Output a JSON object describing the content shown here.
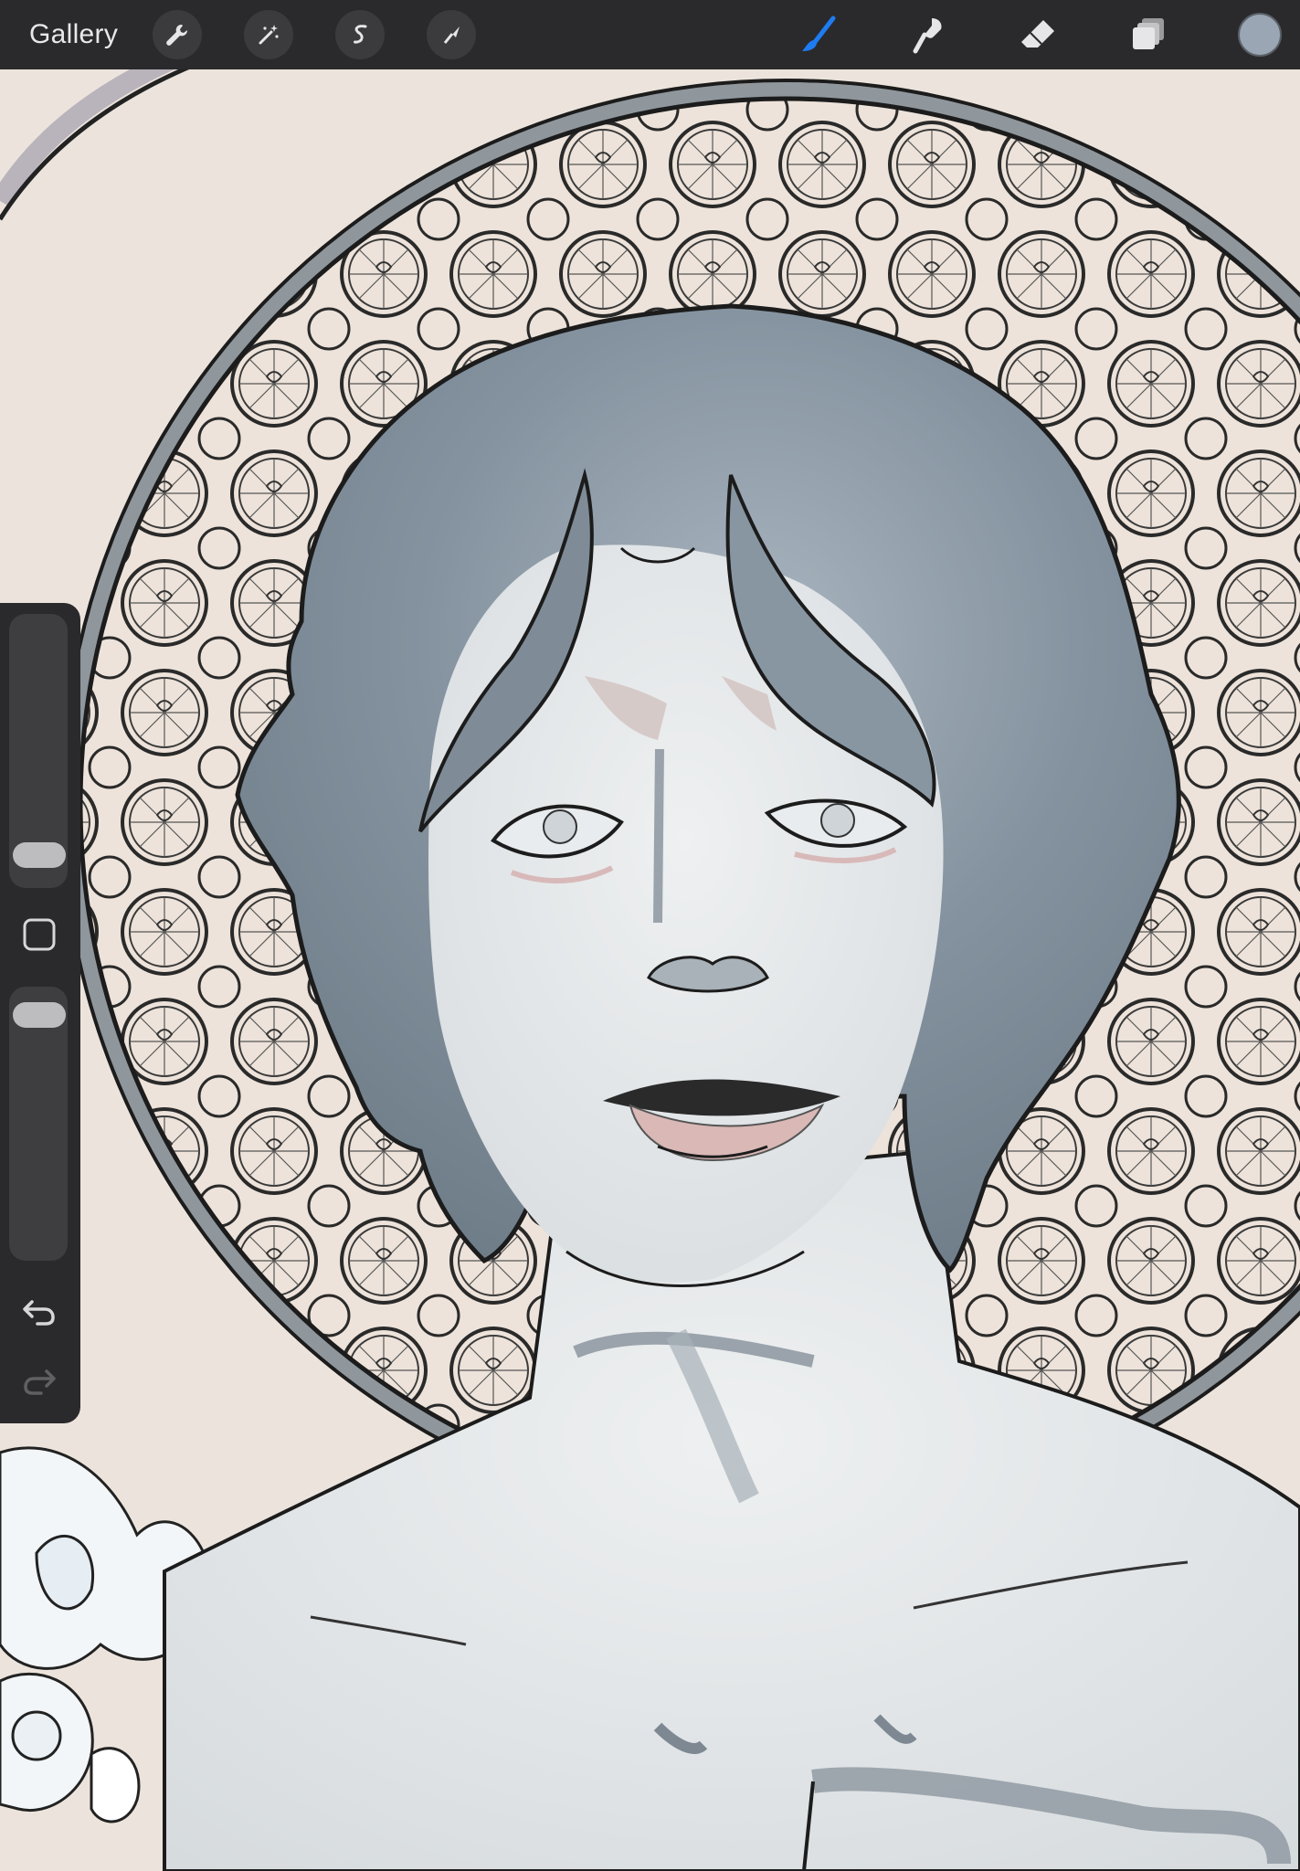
{
  "app": {
    "gallery_label": "Gallery"
  },
  "top_toolbar": {
    "left_tools": [
      {
        "name": "actions",
        "icon": "wrench-icon"
      },
      {
        "name": "adjustments",
        "icon": "magic-wand-icon"
      },
      {
        "name": "selection",
        "icon": "selection-s-icon"
      },
      {
        "name": "transform",
        "icon": "arrow-cursor-icon"
      }
    ],
    "right_tools": [
      {
        "name": "brush",
        "icon": "brush-icon",
        "active": true
      },
      {
        "name": "smudge",
        "icon": "smudge-icon",
        "active": false
      },
      {
        "name": "eraser",
        "icon": "eraser-icon",
        "active": false
      },
      {
        "name": "layers",
        "icon": "layers-icon",
        "active": false
      }
    ],
    "current_color": "#9aa6b4",
    "active_color": "#1e7cf2"
  },
  "sidebar": {
    "brush_size_level": 0.07,
    "brush_opacity_level": 0.95,
    "undo_icon": "undo-icon",
    "redo_icon": "redo-icon",
    "modify_icon": "square-modify-icon"
  },
  "canvas": {
    "background_color": "#ece4dc",
    "skin_color": "#dcdfe2",
    "hair_color": "#7f8c97",
    "ring_color": "#8f979d",
    "lip_color": "#d9b8b6",
    "line_color": "#1c1c1c"
  }
}
